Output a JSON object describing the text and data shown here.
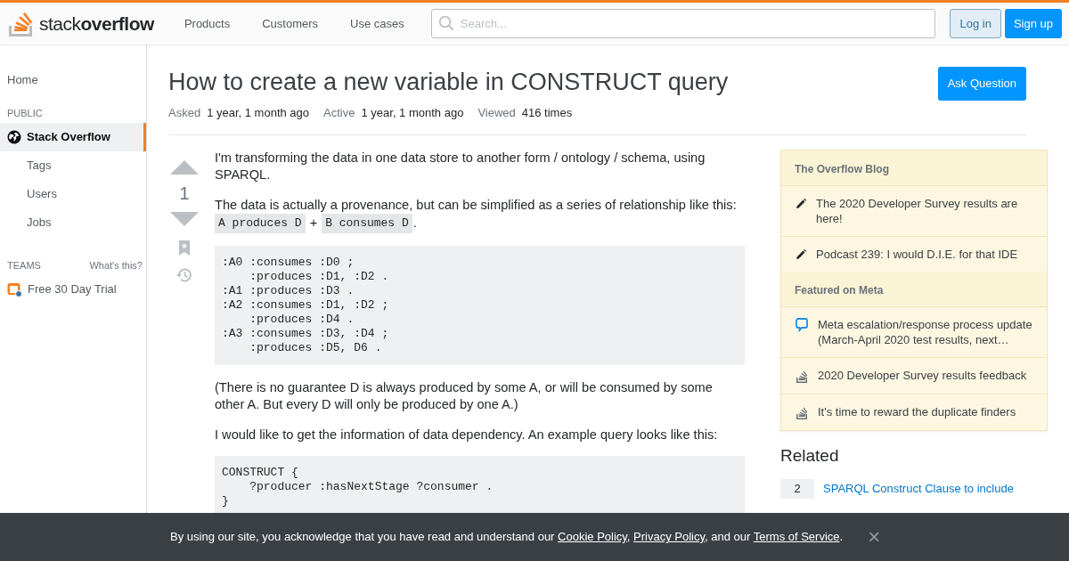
{
  "header": {
    "logo": "stack**overflow**",
    "nav": [
      "Products",
      "Customers",
      "Use cases"
    ],
    "search": {
      "placeholder": "Search..."
    },
    "login": "Log in",
    "signup": "Sign up"
  },
  "sidebar": {
    "home": "Home",
    "sections": [
      {
        "title": "PUBLIC",
        "items": [
          {
            "label": "Stack Overflow",
            "selected": true,
            "kind": "globe"
          },
          {
            "label": "Tags",
            "selected": false,
            "kind": "plain"
          },
          {
            "label": "Users",
            "selected": false,
            "kind": "plain"
          },
          {
            "label": "Jobs",
            "selected": false,
            "kind": "plain"
          }
        ]
      },
      {
        "title": "TEAMS",
        "link": "What's this?",
        "items": [
          {
            "label": "Free 30 Day Trial",
            "selected": false,
            "kind": "teams"
          }
        ]
      }
    ]
  },
  "question": {
    "title": "How to create a new variable in CONSTRUCT query",
    "ask_button": "Ask Question",
    "meta": [
      {
        "label": "Asked",
        "value": "1 year, 1 month ago"
      },
      {
        "label": "Active",
        "value": "1 year, 1 month ago"
      },
      {
        "label": "Viewed",
        "value": "416 times"
      }
    ],
    "votes": "1",
    "body": [
      {
        "kind": "text",
        "text": "I'm transforming the data in one data store to another form / ontology / schema, using SPARQL."
      },
      {
        "kind": "text",
        "text": "The data is actually a provenance, but can be simplified as a series of relationship like this:",
        "segments": [
          {
            "kind": "code",
            "text": "A produces D"
          },
          {
            "kind": "text",
            "text": "+"
          },
          {
            "kind": "code",
            "text": "B consumes D"
          },
          {
            "kind": "text",
            "text": "."
          }
        ]
      },
      {
        "kind": "code",
        "lines": [
          ":A0 :consumes :D0 ;",
          "    :produces :D1, :D2 .",
          ":A1 :produces :D3 .",
          ":A2 :consumes :D1, :D2 ;",
          "    :produces :D4 .",
          ":A3 :consumes :D3, :D4 ;",
          "    :produces :D5, D6 ."
        ]
      },
      {
        "kind": "text",
        "text": "(There is no guarantee D is always produced by some A, or will be consumed by some other A. But every D will only be produced by one A.)"
      },
      {
        "kind": "text",
        "text": "I would like to get the information of data dependency. An example query looks like this:"
      },
      {
        "kind": "code",
        "lines": [
          "CONSTRUCT {",
          "    ?producer :hasNextStage ?consumer .",
          "}"
        ]
      }
    ]
  },
  "widget": {
    "sections": [
      {
        "title": "The Overflow Blog",
        "items": [
          {
            "kind": "pencil",
            "text": "The 2020 Developer Survey results are here!"
          },
          {
            "kind": "pencil",
            "text": "Podcast 239: I would D.I.E. for that IDE"
          }
        ]
      },
      {
        "title": "Featured on Meta",
        "items": [
          {
            "kind": "chat",
            "text": "Meta escalation/response process update (March-April 2020 test results, next…"
          },
          {
            "kind": "stack",
            "text": "2020 Developer Survey results feedback"
          },
          {
            "kind": "stack",
            "text": "It's time to reward the duplicate finders"
          }
        ]
      }
    ]
  },
  "related": {
    "title": "Related",
    "items": [
      {
        "score": "2",
        "title": "SPARQL Construct Clause to include"
      }
    ]
  },
  "cookie_bar": {
    "segments": [
      {
        "kind": "text",
        "text": "By using our site, you acknowledge that you have read and understand our "
      },
      {
        "kind": "link",
        "text": "Cookie Policy"
      },
      {
        "kind": "text",
        "text": ", "
      },
      {
        "kind": "link",
        "text": "Privacy Policy"
      },
      {
        "kind": "text",
        "text": ", and our "
      },
      {
        "kind": "link",
        "text": "Terms of Service"
      },
      {
        "kind": "text",
        "text": "."
      }
    ],
    "close": "×"
  }
}
